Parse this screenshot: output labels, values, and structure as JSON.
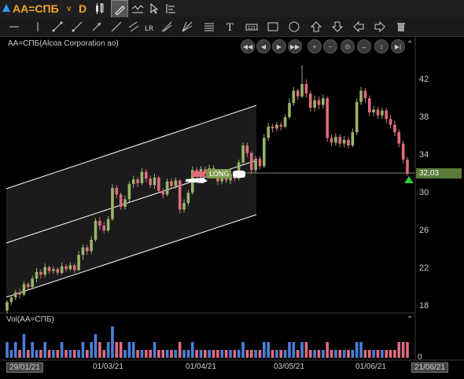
{
  "toolbar": {
    "ticker": "AA=СПБ",
    "interval": "D"
  },
  "chart": {
    "title": "AA=СПБ(Alcoa Corporation ao)",
    "last_price": "32,03",
    "long_label": "LONG",
    "y_ticks": [
      "42",
      "38",
      "34",
      "30",
      "26",
      "22",
      "18"
    ],
    "x_ticks": [
      "29/01/21",
      "01/03/21",
      "01/04/21",
      "03/05/21",
      "01/06/21",
      "21/06/21"
    ],
    "volume_title": "Vol(AA=СПБ)",
    "volume_zero": "0"
  },
  "colors": {
    "up_candle": "#9ab36a",
    "down_candle": "#e06c7e",
    "vol_up": "#4a7fd8",
    "vol_down": "#e06c7e",
    "channel": "#ffffff",
    "last_price_bg": "#5a7a3a",
    "accent": "#f5a623"
  },
  "chart_data": {
    "type": "candlestick",
    "y_axis": [
      16,
      44
    ],
    "candles": [
      [
        17.5,
        18.4,
        17.2,
        18.6
      ],
      [
        18.4,
        18.9,
        18.1,
        19.1
      ],
      [
        18.9,
        19.4,
        18.6,
        19.7
      ],
      [
        19.4,
        19.2,
        18.8,
        19.8
      ],
      [
        19.2,
        20.3,
        19.0,
        20.6
      ],
      [
        20.3,
        20.0,
        19.6,
        20.5
      ],
      [
        20.0,
        20.9,
        19.8,
        21.2
      ],
      [
        20.9,
        21.6,
        20.5,
        22.0
      ],
      [
        21.6,
        21.3,
        20.9,
        21.9
      ],
      [
        21.3,
        22.1,
        21.0,
        22.5
      ],
      [
        22.1,
        21.7,
        21.4,
        22.3
      ],
      [
        21.7,
        21.9,
        21.4,
        22.2
      ],
      [
        21.9,
        21.5,
        21.2,
        22.1
      ],
      [
        21.5,
        22.2,
        21.3,
        22.6
      ],
      [
        22.2,
        21.9,
        21.6,
        22.4
      ],
      [
        21.9,
        22.3,
        21.7,
        22.6
      ],
      [
        22.3,
        21.8,
        21.5,
        22.5
      ],
      [
        21.8,
        23.4,
        21.7,
        23.8
      ],
      [
        23.4,
        24.2,
        22.9,
        24.5
      ],
      [
        24.2,
        23.8,
        23.4,
        24.5
      ],
      [
        23.8,
        25.0,
        23.5,
        25.4
      ],
      [
        25.0,
        27.0,
        24.8,
        27.3
      ],
      [
        27.0,
        26.5,
        26.0,
        27.4
      ],
      [
        26.5,
        26.0,
        25.7,
        26.9
      ],
      [
        26.0,
        27.2,
        25.8,
        27.5
      ],
      [
        27.2,
        30.5,
        27.0,
        30.9
      ],
      [
        30.5,
        29.8,
        29.4,
        30.8
      ],
      [
        29.8,
        28.5,
        28.2,
        30.0
      ],
      [
        28.5,
        29.3,
        28.2,
        29.7
      ],
      [
        29.3,
        30.9,
        29.0,
        31.2
      ],
      [
        30.9,
        31.4,
        30.5,
        31.8
      ],
      [
        31.4,
        31.0,
        30.6,
        31.7
      ],
      [
        31.0,
        32.2,
        30.8,
        32.6
      ],
      [
        32.2,
        31.5,
        31.1,
        32.5
      ],
      [
        31.5,
        30.8,
        30.5,
        31.8
      ],
      [
        30.8,
        31.6,
        30.4,
        32.0
      ],
      [
        31.6,
        30.2,
        30.0,
        31.8
      ],
      [
        30.2,
        29.8,
        29.4,
        30.5
      ],
      [
        29.8,
        31.2,
        29.6,
        31.5
      ],
      [
        31.2,
        30.7,
        30.4,
        31.5
      ],
      [
        30.7,
        31.3,
        30.4,
        31.6
      ],
      [
        31.3,
        28.2,
        27.8,
        31.4
      ],
      [
        28.2,
        28.9,
        27.9,
        29.3
      ],
      [
        28.9,
        30.0,
        28.6,
        30.3
      ],
      [
        30.0,
        32.4,
        29.8,
        32.8
      ],
      [
        32.4,
        31.8,
        31.5,
        32.7
      ],
      [
        31.8,
        32.5,
        31.4,
        32.8
      ],
      [
        32.5,
        32.0,
        31.6,
        32.8
      ],
      [
        32.0,
        32.6,
        31.7,
        33.0
      ],
      [
        32.6,
        31.8,
        31.5,
        32.9
      ],
      [
        31.8,
        31.2,
        30.8,
        32.1
      ],
      [
        31.2,
        31.9,
        30.9,
        32.2
      ],
      [
        31.9,
        31.3,
        31.0,
        32.1
      ],
      [
        31.3,
        32.0,
        30.9,
        32.3
      ],
      [
        32.0,
        31.5,
        31.2,
        32.3
      ],
      [
        31.5,
        33.2,
        31.3,
        33.5
      ],
      [
        33.2,
        35.0,
        33.0,
        35.3
      ],
      [
        35.0,
        34.2,
        33.8,
        35.3
      ],
      [
        34.2,
        32.4,
        32.0,
        34.4
      ],
      [
        32.4,
        33.6,
        32.1,
        33.9
      ],
      [
        33.6,
        32.8,
        32.5,
        33.9
      ],
      [
        32.8,
        35.8,
        32.6,
        36.2
      ],
      [
        35.8,
        37.0,
        35.5,
        37.4
      ],
      [
        37.0,
        36.8,
        36.4,
        37.3
      ],
      [
        36.8,
        37.2,
        36.5,
        37.5
      ],
      [
        37.2,
        37.0,
        36.6,
        37.5
      ],
      [
        37.0,
        38.0,
        36.8,
        38.3
      ],
      [
        38.0,
        39.5,
        37.8,
        40.0
      ],
      [
        39.5,
        40.8,
        39.2,
        41.2
      ],
      [
        40.8,
        40.2,
        39.8,
        41.0
      ],
      [
        40.2,
        41.5,
        40.0,
        43.5
      ],
      [
        41.5,
        40.5,
        40.1,
        42.0
      ],
      [
        40.5,
        39.0,
        38.6,
        40.8
      ],
      [
        39.0,
        39.8,
        38.6,
        40.3
      ],
      [
        39.8,
        39.3,
        38.8,
        40.2
      ],
      [
        39.3,
        40.0,
        38.9,
        40.4
      ],
      [
        40.0,
        35.8,
        35.4,
        40.2
      ],
      [
        35.8,
        35.3,
        34.9,
        36.2
      ],
      [
        35.3,
        35.9,
        35.0,
        36.3
      ],
      [
        35.9,
        35.2,
        34.8,
        36.2
      ],
      [
        35.2,
        35.6,
        34.8,
        36.0
      ],
      [
        35.6,
        35.0,
        34.7,
        35.9
      ],
      [
        35.0,
        36.4,
        34.8,
        36.8
      ],
      [
        36.4,
        39.6,
        36.1,
        40.0
      ],
      [
        39.6,
        40.8,
        39.3,
        41.2
      ],
      [
        40.8,
        40.0,
        39.5,
        41.1
      ],
      [
        40.0,
        38.5,
        38.1,
        40.3
      ],
      [
        38.5,
        38.8,
        38.1,
        39.2
      ],
      [
        38.8,
        38.2,
        37.8,
        39.1
      ],
      [
        38.2,
        38.7,
        37.8,
        39.0
      ],
      [
        38.7,
        37.8,
        37.4,
        39.0
      ],
      [
        37.8,
        37.2,
        36.8,
        38.2
      ],
      [
        37.2,
        36.4,
        36.0,
        37.6
      ],
      [
        36.4,
        35.2,
        34.8,
        36.7
      ],
      [
        35.2,
        33.5,
        33.1,
        35.5
      ],
      [
        33.5,
        32.0,
        31.8,
        33.8
      ]
    ],
    "volumes": [
      [
        1,
        2
      ],
      [
        1,
        1
      ],
      [
        1,
        2
      ],
      [
        0,
        1
      ],
      [
        1,
        3
      ],
      [
        0,
        1
      ],
      [
        1,
        2
      ],
      [
        1,
        1
      ],
      [
        0,
        1
      ],
      [
        1,
        2
      ],
      [
        0,
        1
      ],
      [
        1,
        1
      ],
      [
        0,
        1
      ],
      [
        1,
        2
      ],
      [
        0,
        1
      ],
      [
        1,
        1
      ],
      [
        0,
        1
      ],
      [
        1,
        1
      ],
      [
        1,
        2
      ],
      [
        0,
        1
      ],
      [
        1,
        2
      ],
      [
        1,
        3
      ],
      [
        0,
        2
      ],
      [
        0,
        1
      ],
      [
        1,
        2
      ],
      [
        1,
        4
      ],
      [
        0,
        2
      ],
      [
        0,
        2
      ],
      [
        1,
        1
      ],
      [
        1,
        2
      ],
      [
        1,
        2
      ],
      [
        0,
        1
      ],
      [
        1,
        1
      ],
      [
        0,
        1
      ],
      [
        0,
        1
      ],
      [
        1,
        2
      ],
      [
        0,
        1
      ],
      [
        0,
        1
      ],
      [
        1,
        1
      ],
      [
        0,
        1
      ],
      [
        1,
        1
      ],
      [
        0,
        2
      ],
      [
        1,
        1
      ],
      [
        1,
        1
      ],
      [
        1,
        2
      ],
      [
        0,
        1
      ],
      [
        1,
        1
      ],
      [
        0,
        1
      ],
      [
        1,
        1
      ],
      [
        0,
        1
      ],
      [
        0,
        1
      ],
      [
        1,
        1
      ],
      [
        0,
        1
      ],
      [
        1,
        1
      ],
      [
        0,
        1
      ],
      [
        1,
        1
      ],
      [
        1,
        2
      ],
      [
        0,
        1
      ],
      [
        0,
        1
      ],
      [
        1,
        1
      ],
      [
        0,
        1
      ],
      [
        1,
        2
      ],
      [
        1,
        2
      ],
      [
        0,
        1
      ],
      [
        1,
        1
      ],
      [
        0,
        1
      ],
      [
        1,
        1
      ],
      [
        1,
        2
      ],
      [
        1,
        2
      ],
      [
        0,
        1
      ],
      [
        1,
        2
      ],
      [
        0,
        2
      ],
      [
        0,
        1
      ],
      [
        1,
        1
      ],
      [
        0,
        1
      ],
      [
        1,
        1
      ],
      [
        0,
        2
      ],
      [
        0,
        1
      ],
      [
        1,
        1
      ],
      [
        0,
        1
      ],
      [
        1,
        1
      ],
      [
        0,
        1
      ],
      [
        1,
        1
      ],
      [
        1,
        2
      ],
      [
        1,
        2
      ],
      [
        0,
        1
      ],
      [
        0,
        1
      ],
      [
        1,
        1
      ],
      [
        0,
        1
      ],
      [
        1,
        1
      ],
      [
        0,
        1
      ],
      [
        0,
        1
      ],
      [
        0,
        1
      ],
      [
        0,
        2
      ],
      [
        0,
        2
      ],
      [
        0,
        2
      ]
    ]
  }
}
